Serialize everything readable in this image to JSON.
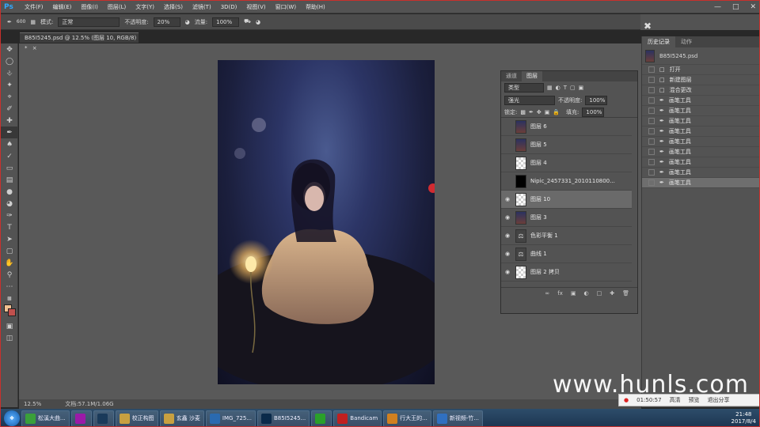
{
  "menubar": {
    "logo": "Ps",
    "items": [
      "文件(F)",
      "编辑(E)",
      "图像(I)",
      "图层(L)",
      "文字(Y)",
      "选择(S)",
      "滤镜(T)",
      "3D(D)",
      "视图(V)",
      "窗口(W)",
      "帮助(H)"
    ]
  },
  "options": {
    "brush_size": "600",
    "mode_label": "模式:",
    "mode_value": "正常",
    "opacity_label": "不透明度:",
    "opacity_value": "20%",
    "flow_label": "流量:",
    "flow_value": "100%"
  },
  "document": {
    "tab_title": "B85I5245.psd @ 12.5% (图层 10, RGB/8) *",
    "zoom": "12.5%",
    "doc_info": "文档:57.1M/1.06G"
  },
  "history": {
    "tabs": [
      "历史记录",
      "动作"
    ],
    "snapshot": "B85I5245.psd",
    "rows": [
      "打开",
      "新建图层",
      "混合更改",
      "画笔工具",
      "画笔工具",
      "画笔工具",
      "画笔工具",
      "画笔工具",
      "画笔工具",
      "画笔工具",
      "画笔工具",
      "画笔工具"
    ],
    "selected_index": 11
  },
  "layers_panel": {
    "tabs": [
      "通道",
      "图层"
    ],
    "filter": "类型",
    "blend": "强光",
    "opacity_label": "不透明度:",
    "opacity": "100%",
    "lock_label": "锁定:",
    "fill_label": "填充:",
    "fill": "100%",
    "layers": [
      {
        "name": "图层 6",
        "thumb": "img",
        "eye": false
      },
      {
        "name": "图层 5",
        "thumb": "img",
        "eye": false
      },
      {
        "name": "图层 4",
        "thumb": "tr",
        "eye": false
      },
      {
        "name": "Nipic_2457331_2010110800...",
        "thumb": "blk",
        "eye": false
      },
      {
        "name": "图层 10",
        "thumb": "tr",
        "eye": true,
        "selected": true
      },
      {
        "name": "图层 3",
        "thumb": "img",
        "eye": true
      },
      {
        "name": "色彩平衡 1",
        "thumb": "adj",
        "eye": true
      },
      {
        "name": "曲线 1",
        "thumb": "adj",
        "eye": true
      },
      {
        "name": "图层 2 拷贝",
        "thumb": "tr",
        "eye": true
      }
    ]
  },
  "taskbar": {
    "items": [
      "松溪大曲...",
      "",
      "",
      "校正构图",
      "玄鑫 沙麦",
      "IMG_725...",
      "B85I5245...",
      "",
      "Bandicam",
      "行大王的...",
      "新视频-竹..."
    ],
    "time": "21:48",
    "date": "2017/8/4"
  },
  "recorder": {
    "time": "01:50:57",
    "btn1": "高清",
    "btn2": "预览",
    "btn3": "退出分享"
  },
  "watermark": "www.hunls.com"
}
